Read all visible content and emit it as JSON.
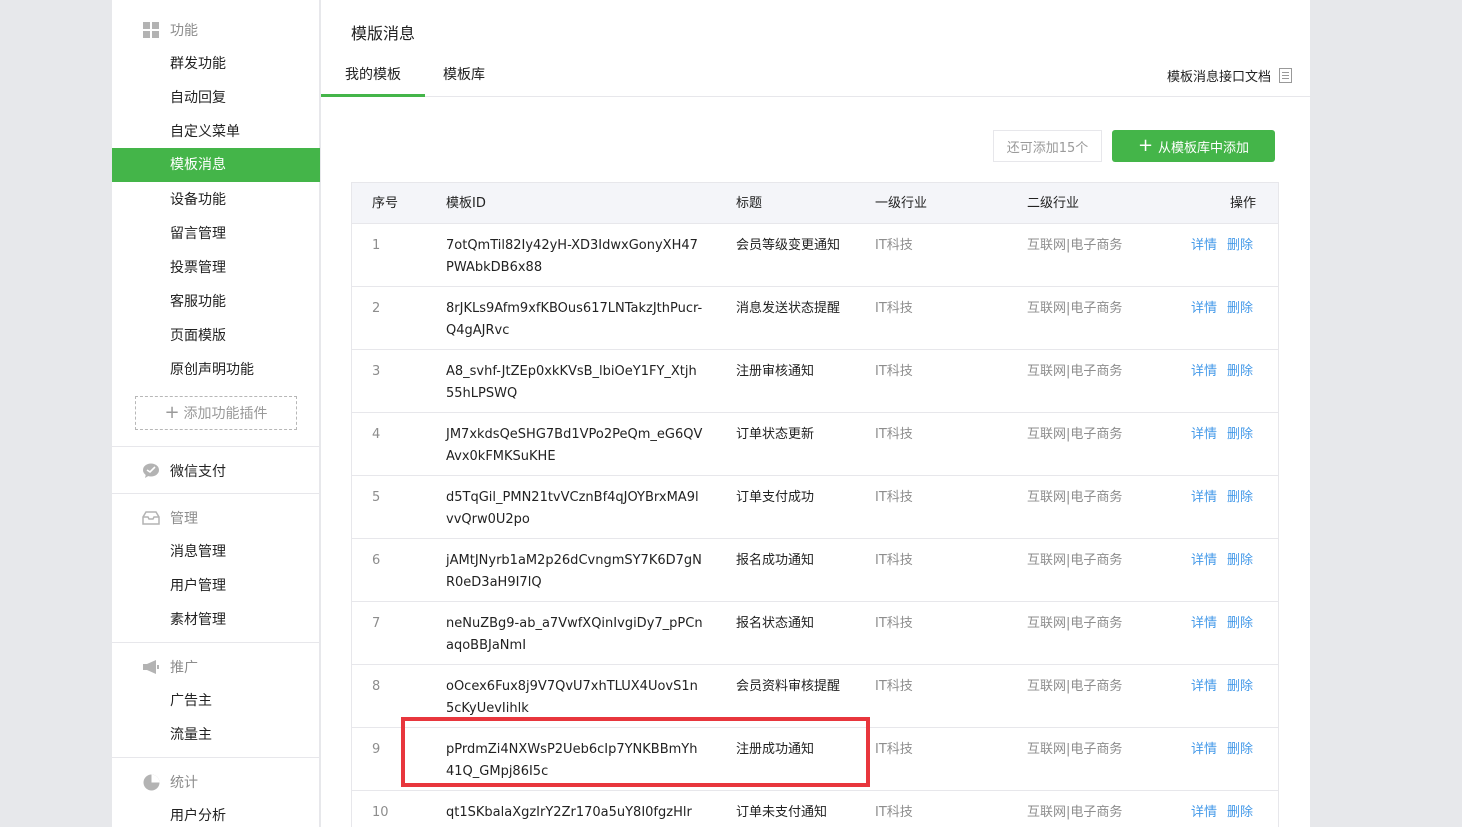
{
  "sidebar": {
    "groups": [
      {
        "title": "功能",
        "icon": "grid-icon"
      },
      {
        "title": "微信支付",
        "icon": "chat-bubble-icon"
      },
      {
        "title": "管理",
        "icon": "inbox-icon"
      },
      {
        "title": "推广",
        "icon": "megaphone-icon"
      },
      {
        "title": "统计",
        "icon": "pie-chart-icon"
      }
    ],
    "feature_items": [
      "群发功能",
      "自动回复",
      "自定义菜单",
      "模板消息",
      "设备功能",
      "留言管理",
      "投票管理",
      "客服功能",
      "页面模版",
      "原创声明功能"
    ],
    "active_item": "模板消息",
    "add_plugin_label": "添加功能插件",
    "manage_items": [
      "消息管理",
      "用户管理",
      "素材管理"
    ],
    "promo_items": [
      "广告主",
      "流量主"
    ],
    "stats_items": [
      "用户分析"
    ]
  },
  "main": {
    "title": "模版消息",
    "tabs": [
      {
        "label": "我的模板"
      },
      {
        "label": "模板库"
      }
    ],
    "active_tab": "我的模板",
    "doc_link": "模板消息接口文档",
    "remaining": "还可添加15个",
    "add_button": "从模板库中添加",
    "table": {
      "headers": [
        "序号",
        "模板ID",
        "标题",
        "一级行业",
        "二级行业",
        "操作"
      ],
      "rows": [
        {
          "no": "1",
          "id": "7otQmTil82Iy42yH-XD3IdwxGonyXH47PWAbkDB6x88",
          "title": "会员等级变更通知",
          "ind1": "IT科技",
          "ind2": "互联网|电子商务"
        },
        {
          "no": "2",
          "id": "8rJKLs9Afm9xfKBOus617LNTakzJthPucr-Q4gAJRvc",
          "title": "消息发送状态提醒",
          "ind1": "IT科技",
          "ind2": "互联网|电子商务"
        },
        {
          "no": "3",
          "id": "A8_svhf-JtZEp0xkKVsB_lbiOeY1FY_Xtjh55hLPSWQ",
          "title": "注册审核通知",
          "ind1": "IT科技",
          "ind2": "互联网|电子商务"
        },
        {
          "no": "4",
          "id": "JM7xkdsQeSHG7Bd1VPo2PeQm_eG6QVAvx0kFMKSuKHE",
          "title": "订单状态更新",
          "ind1": "IT科技",
          "ind2": "互联网|电子商务"
        },
        {
          "no": "5",
          "id": "d5TqGil_PMN21tvVCznBf4qJOYBrxMA9lvvQrw0U2po",
          "title": "订单支付成功",
          "ind1": "IT科技",
          "ind2": "互联网|电子商务"
        },
        {
          "no": "6",
          "id": "jAMtJNyrb1aM2p26dCvngmSY7K6D7gNR0eD3aH9I7lQ",
          "title": "报名成功通知",
          "ind1": "IT科技",
          "ind2": "互联网|电子商务"
        },
        {
          "no": "7",
          "id": "neNuZBg9-ab_a7VwfXQinIvgiDy7_pPCnaqoBBJaNmI",
          "title": "报名状态通知",
          "ind1": "IT科技",
          "ind2": "互联网|电子商务"
        },
        {
          "no": "8",
          "id": "oOcex6Fux8j9V7QvU7xhTLUX4UovS1n5cKyUevIihlk",
          "title": "会员资料审核提醒",
          "ind1": "IT科技",
          "ind2": "互联网|电子商务"
        },
        {
          "no": "9",
          "id": "pPrdmZi4NXWsP2Ueb6cIp7YNKBBmYh41Q_GMpj86I5c",
          "title": "注册成功通知",
          "ind1": "IT科技",
          "ind2": "互联网|电子商务"
        },
        {
          "no": "10",
          "id": "qt1SKbalaXgzIrY2Zr170a5uY8I0fgzHlr",
          "title": "订单未支付通知",
          "ind1": "IT科技",
          "ind2": "互联网|电子商务"
        }
      ],
      "ops": [
        "详情",
        "删除"
      ]
    }
  },
  "colors": {
    "accent": "#44b549",
    "link": "#459ae9",
    "highlight": "#e8363d"
  }
}
